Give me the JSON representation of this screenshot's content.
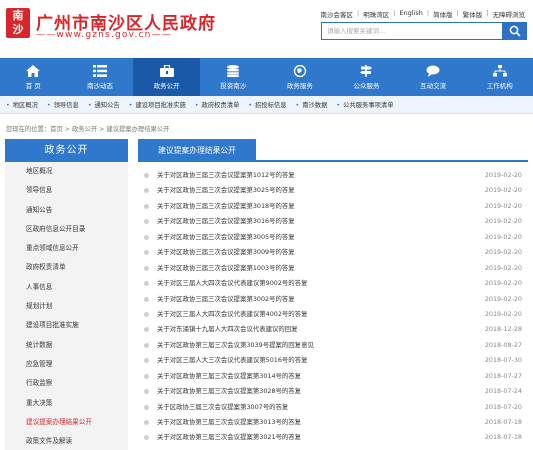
{
  "header": {
    "seal": "南沙",
    "title": "广州市南沙区人民政府",
    "url": "——www.gzns.gov.cn——",
    "links": [
      "南沙会客区",
      "明珠湾区",
      "English",
      "简体版",
      "繁体版",
      "无障碍浏览"
    ],
    "search": {
      "placeholder": "请输入搜索关键词..."
    }
  },
  "nav": [
    {
      "label": "首 页",
      "icon": "home-icon"
    },
    {
      "label": "南沙动态",
      "icon": "list-icon"
    },
    {
      "label": "政务公开",
      "icon": "briefcase-icon",
      "active": true
    },
    {
      "label": "投资南沙",
      "icon": "coins-icon"
    },
    {
      "label": "政务服务",
      "icon": "globe-icon"
    },
    {
      "label": "公众服务",
      "icon": "signpost-icon"
    },
    {
      "label": "互动交流",
      "icon": "chat-icon"
    },
    {
      "label": "工作机构",
      "icon": "org-chart-icon"
    }
  ],
  "subnav": [
    "地区概况",
    "领导信息",
    "通知公告",
    "建设项目批准实施",
    "政府权责清单",
    "招投标信息",
    "南沙数据",
    "公共服务事项清单"
  ],
  "breadcrumb": "您现在的位置：首页 > 政务公开 > 建议提案办理结果公开",
  "sidebar": {
    "title": "政务公开",
    "items": [
      "地区概况",
      "领导信息",
      "通知公告",
      "区政府信息公开目录",
      "重点领域信息公开",
      "政府权责清单",
      "人事信息",
      "规划计划",
      "建设项目批准实施",
      "统计数据",
      "应急管理",
      "行政监察",
      "重大决策",
      "建议提案办理结果公开",
      "政策文件及解读"
    ],
    "active_index": 13
  },
  "main": {
    "title": "建议提案办理结果公开",
    "rows": [
      {
        "title": "关于对区政协三届三次会议提案第1012号的答复",
        "date": "2019-02-20"
      },
      {
        "title": "关于对区政协三届三次会议提案第3025号的答复",
        "date": "2019-02-20"
      },
      {
        "title": "关于对区政协三届三次会议提案第3018号的答复",
        "date": "2019-02-20"
      },
      {
        "title": "关于对区政协三届三次会议提案第3016号的答复",
        "date": "2019-02-20"
      },
      {
        "title": "关于对区政协三届三次会议提案第3005号的答复",
        "date": "2019-02-20"
      },
      {
        "title": "关于对区政协三届三次会议提案第3009号的答复",
        "date": "2019-02-20"
      },
      {
        "title": "关于对区政协三届三次会议提案第1003号的答复",
        "date": "2019-02-20"
      },
      {
        "title": "关于对区三届人大四次会议代表建议第9002号的答复",
        "date": "2019-02-20"
      },
      {
        "title": "关于对区政协三届三次会议提案第3002号的答复",
        "date": "2019-02-20"
      },
      {
        "title": "关于对区三届人大四次会议代表建议第4002号的答复",
        "date": "2019-02-20"
      },
      {
        "title": "关于对东涌镇十九届人大四次会议代表建议的回复",
        "date": "2018-12-28"
      },
      {
        "title": "关于对区政协第三届三次会议第3039号提案的回复意见",
        "date": "2018-08-27"
      },
      {
        "title": "关于对区三届人大三次会议代表建议第5016号的答复",
        "date": "2018-07-30"
      },
      {
        "title": "关于对区政协第三届三次会议提案第3014号的答复",
        "date": "2018-07-27"
      },
      {
        "title": "关于对区政协第三届三次会议提案第3028号的答复",
        "date": "2018-07-24"
      },
      {
        "title": "关于区政协三届三次会议提案第3007号的答复",
        "date": "2018-07-20"
      },
      {
        "title": "关于对区政协第三届三次会议提案第3013号的答复",
        "date": "2018-07-18"
      },
      {
        "title": "关于对区政协第三届三次会议提案第3021号的答复",
        "date": "2018-07-18"
      }
    ]
  },
  "colors": {
    "brand_red": "#d8262a",
    "nav_blue": "#2f78cc",
    "nav_active": "#1a59a8"
  }
}
